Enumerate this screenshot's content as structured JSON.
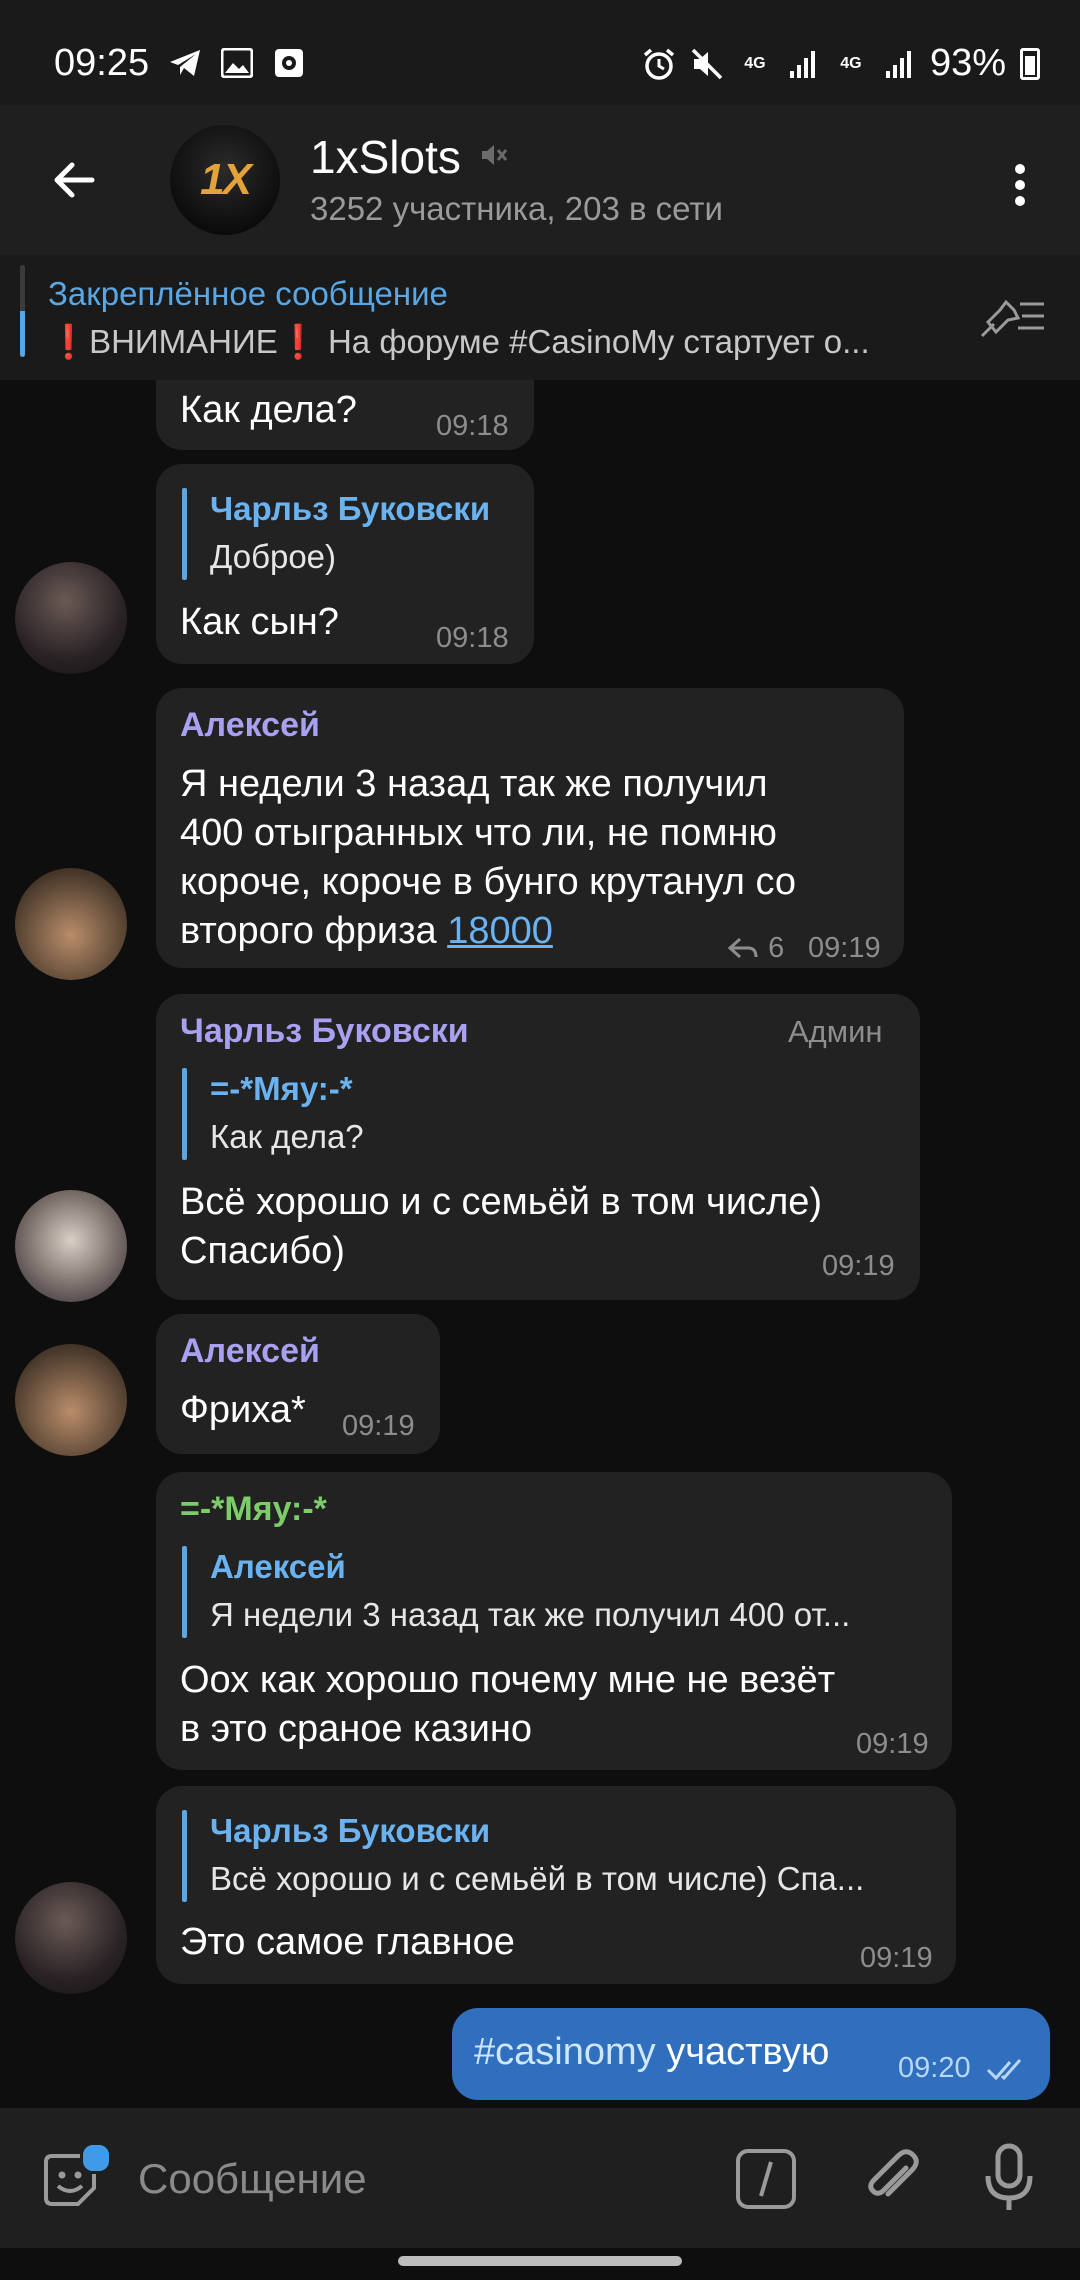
{
  "status_bar": {
    "time": "09:25",
    "battery": "93%",
    "icons_left": [
      "telegram-icon",
      "gallery-icon",
      "screen-record-icon"
    ],
    "icons_right": [
      "alarm-icon",
      "mute-icon",
      "data-4g-icon",
      "signal-icon",
      "data-4g-icon",
      "signal-icon"
    ]
  },
  "header": {
    "title": "1xSlots",
    "subtitle": "3252 участника, 203 в сети",
    "avatar_text": "1X"
  },
  "pinned": {
    "title": "Закреплённое сообщение",
    "text": "❗ВНИМАНИЕ❗ На форуме #CasinoMy стартует о..."
  },
  "messages": [
    {
      "text": "Как дела?",
      "time": "09:18"
    },
    {
      "reply_name": "Чарльз Буковски",
      "reply_text": "Доброе)",
      "text": "Как сын?",
      "time": "09:18"
    },
    {
      "sender": "Алексей",
      "text_lines": [
        "Я недели 3 назад так же получил",
        "400 отыгранных что ли, не помню",
        "короче, короче в бунго крутанул со",
        "второго фриза "
      ],
      "link": "18000",
      "replies": "6",
      "time": "09:19"
    },
    {
      "sender": "Чарльз Буковски",
      "badge": "Админ",
      "reply_name": "=-*Мяу:-*",
      "reply_text": "Как дела?",
      "text_lines": [
        "Всё хорошо и с семьёй в том числе)",
        "Спасибо)"
      ],
      "time": "09:19"
    },
    {
      "sender": "Алексей",
      "text": "Фриха*",
      "time": "09:19"
    },
    {
      "sender": "=-*Мяу:-*",
      "reply_name": "Алексей",
      "reply_text": "Я недели 3 назад так же получил 400 от...",
      "text_lines": [
        "Оох как хорошо почему мне не везёт",
        "в это сраное казино"
      ],
      "time": "09:19"
    },
    {
      "reply_name": "Чарльз Буковски",
      "reply_text": "Всё хорошо и с семьёй в том числе) Спа...",
      "text": "Это самое главное",
      "time": "09:19"
    },
    {
      "hashtag": "#casinomy",
      "text": " участвую",
      "time": "09:20"
    }
  ],
  "input": {
    "placeholder": "Сообщение"
  },
  "colors": {
    "accent": "#5aa7e6",
    "sender_alexey": "#a8a0f0",
    "sender_charles": "#a8a0f0",
    "sender_myau": "#7ccc6a",
    "outgoing": "#2f6fbd"
  }
}
